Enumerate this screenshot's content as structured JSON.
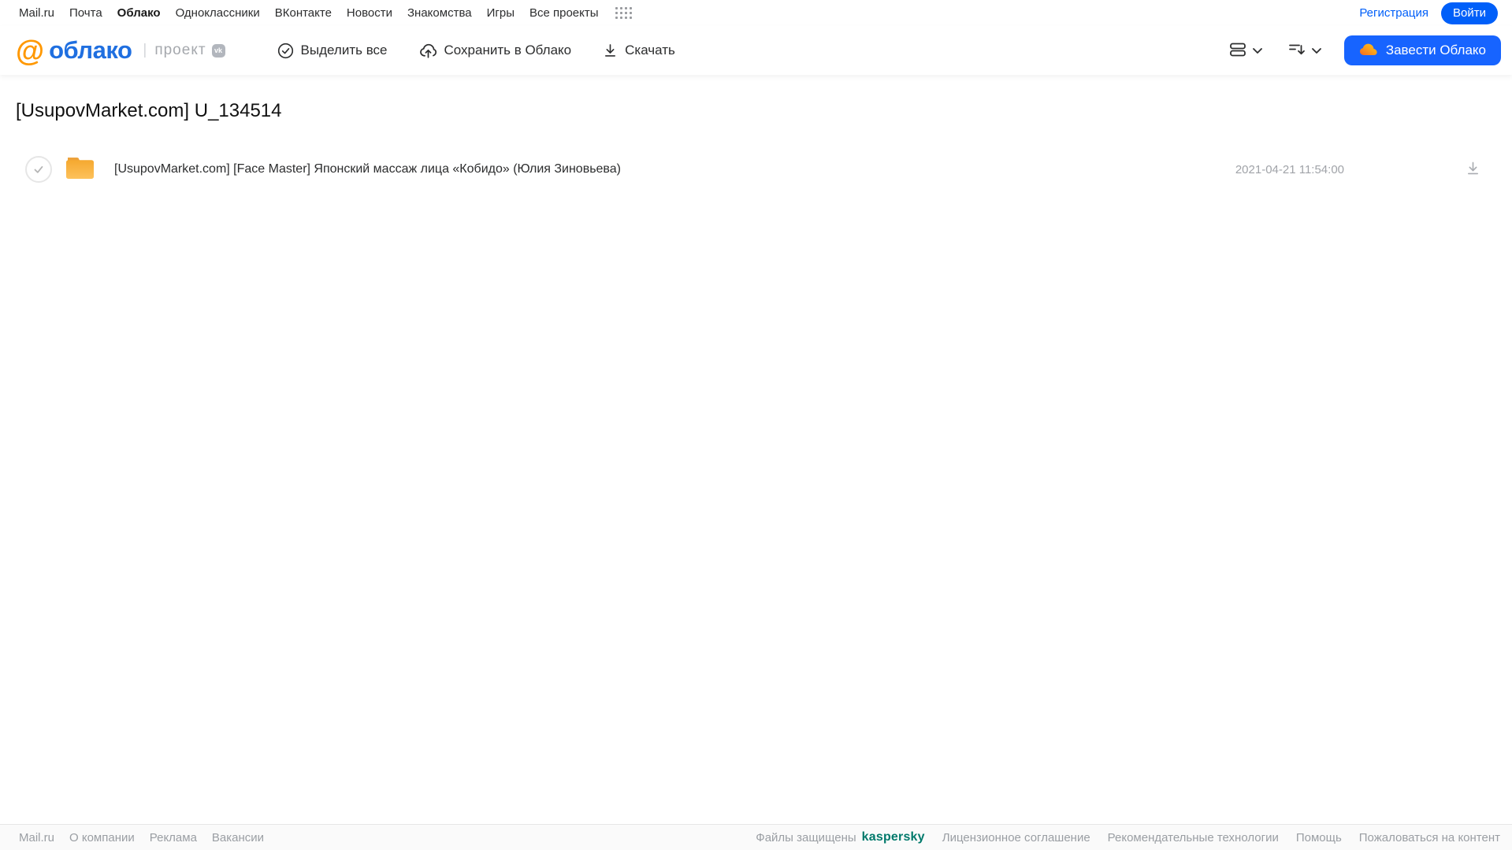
{
  "colors": {
    "accent_blue": "#005ff9",
    "button_blue": "#1764ff",
    "logo_blue": "#1f6fe0",
    "logo_orange": "#ff9800",
    "folder_yellow": "#f9b13b",
    "kaspersky_green": "#00796b"
  },
  "top_nav": {
    "links": [
      {
        "label": "Mail.ru"
      },
      {
        "label": "Почта"
      },
      {
        "label": "Облако",
        "active": true
      },
      {
        "label": "Одноклассники"
      },
      {
        "label": "ВКонтакте"
      },
      {
        "label": "Новости"
      },
      {
        "label": "Знакомства"
      },
      {
        "label": "Игры"
      },
      {
        "label": "Все проекты"
      }
    ],
    "register_label": "Регистрация",
    "login_label": "Войти"
  },
  "header": {
    "logo_text": "облако",
    "project_label": "проект",
    "vk_badge": "vk",
    "toolbar": {
      "select_all_label": "Выделить все",
      "save_to_cloud_label": "Сохранить в Облако",
      "download_label": "Скачать"
    },
    "get_cloud_label": "Завести Облако"
  },
  "page": {
    "title": "[UsupovMarket.com] U_134514"
  },
  "files": [
    {
      "type": "folder",
      "name": "[UsupovMarket.com] [Face Master] Японский массаж лица «Кобидо» (Юлия Зиновьева)",
      "date": "2021-04-21 11:54:00"
    }
  ],
  "footer": {
    "left_links": [
      "Mail.ru",
      "О компании",
      "Реклама",
      "Вакансии"
    ],
    "protected_text": "Файлы защищены",
    "kaspersky_label": "kaspersky",
    "right_links": [
      "Лицензионное соглашение",
      "Рекомендательные технологии",
      "Помощь",
      "Пожаловаться на контент"
    ]
  }
}
